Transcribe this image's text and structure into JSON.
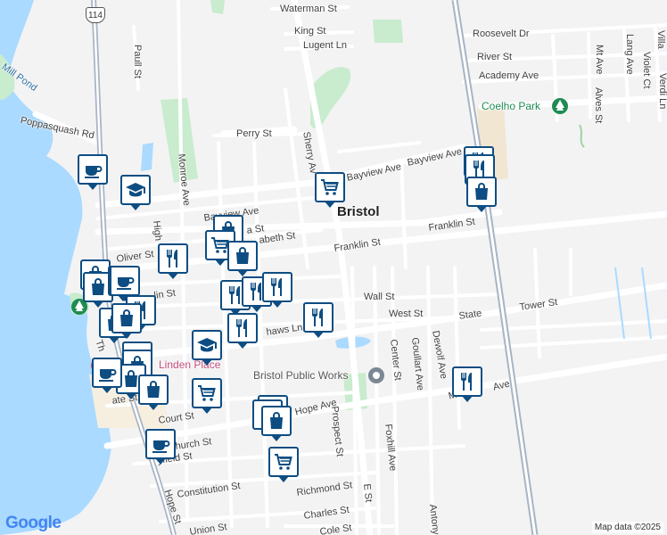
{
  "map": {
    "town_label": "Bristol",
    "route_shield": "114",
    "google_logo": "Google",
    "attribution": "Map data ©2025",
    "colors": {
      "water": "#aadaff",
      "park": "#c8eccd",
      "road": "#ffffff",
      "highway": "#a8b4c4",
      "marker_border": "#0d4d82"
    }
  },
  "streets": {
    "waterman": "Waterman St",
    "king": "King St",
    "lugent": "Lugent Ln",
    "roosevelt": "Roosevelt Dr",
    "river": "River St",
    "academy": "Academy Ave",
    "mt_ave": "Mt Ave",
    "lang": "Lang Ave",
    "villa": "Villa",
    "violet": "Violet Ct",
    "verdi": "Verdi Ln",
    "alves": "Alves St",
    "paull": "Paull St",
    "poppasquash": "Poppasquash Rd",
    "perry": "Perry St",
    "sherry": "Sherry Av",
    "bayview_w": "Bayview Ave",
    "bayview_mid": "Bayview Ave",
    "bayview_e": "Bayview Ave",
    "monroe": "Monroe Ave",
    "high": "High",
    "oliver": "Oliver St",
    "elizabeth": "abeth St",
    "a_st": "a St",
    "franklin_mid": "Franklin St",
    "franklin_e": "Franklin St",
    "franklin_w": "lin St",
    "wall": "Wall St",
    "west": "West St",
    "state": "State",
    "tower": "Tower St",
    "shaws": "haws Ln",
    "center": "Center St",
    "goullart": "Goullart Ave",
    "dewolf": "Dewolf Ave",
    "court": "Court St",
    "hope_ave": "Hope Ave",
    "church": "hurch St",
    "bayfield": "yfield St",
    "constitution": "Constitution St",
    "prospect": "Prospect St",
    "foxhill": "Foxhill Ave",
    "richmond": "Richmond St",
    "charles": "Charles St",
    "e_st": "E St",
    "antony": "Antony",
    "union": "Union St",
    "cole": "Cole St",
    "hope_st": "Hope St",
    "metacom": "M",
    "metacom_ave": "Ave",
    "thames": "Th",
    "state_w": "ate St"
  },
  "places": {
    "mill_pond": "Mill Pond",
    "coelho_park": "Coelho Park",
    "linden_place": "Linden Place",
    "public_works": "Bristol Public Works"
  },
  "markers": [
    {
      "icon": "coffee-icon"
    },
    {
      "icon": "school-icon"
    },
    {
      "icon": "shopping-cart-icon"
    },
    {
      "icon": "restaurant-icon"
    },
    {
      "icon": "restaurant-icon"
    },
    {
      "icon": "shopping-bag-icon"
    },
    {
      "icon": "shopping-bag-icon"
    },
    {
      "icon": "restaurant-icon"
    },
    {
      "icon": "shopping-cart-icon"
    },
    {
      "icon": "shopping-bag-icon"
    },
    {
      "icon": "shopping-bag-icon"
    },
    {
      "icon": "shopping-bag-icon"
    },
    {
      "icon": "restaurant-icon"
    },
    {
      "icon": "coffee-icon"
    },
    {
      "icon": "restaurant-icon"
    },
    {
      "icon": "restaurant-icon"
    },
    {
      "icon": "restaurant-icon"
    },
    {
      "icon": "restaurant-icon"
    },
    {
      "icon": "shopping-bag-icon"
    },
    {
      "icon": "shopping-bag-icon"
    },
    {
      "icon": "school-icon"
    },
    {
      "icon": "school-icon"
    },
    {
      "icon": "shopping-bag-icon"
    },
    {
      "icon": "shopping-bag-icon"
    },
    {
      "icon": "coffee-icon"
    },
    {
      "icon": "shopping-bag-icon"
    },
    {
      "icon": "shopping-bag-icon"
    },
    {
      "icon": "shopping-cart-icon"
    },
    {
      "icon": "shopping-bag-icon"
    },
    {
      "icon": "shopping-bag-icon"
    },
    {
      "icon": "coffee-icon"
    },
    {
      "icon": "shopping-cart-icon"
    },
    {
      "icon": "restaurant-icon"
    },
    {
      "icon": "restaurant-icon"
    },
    {
      "icon": "restaurant-icon"
    }
  ]
}
